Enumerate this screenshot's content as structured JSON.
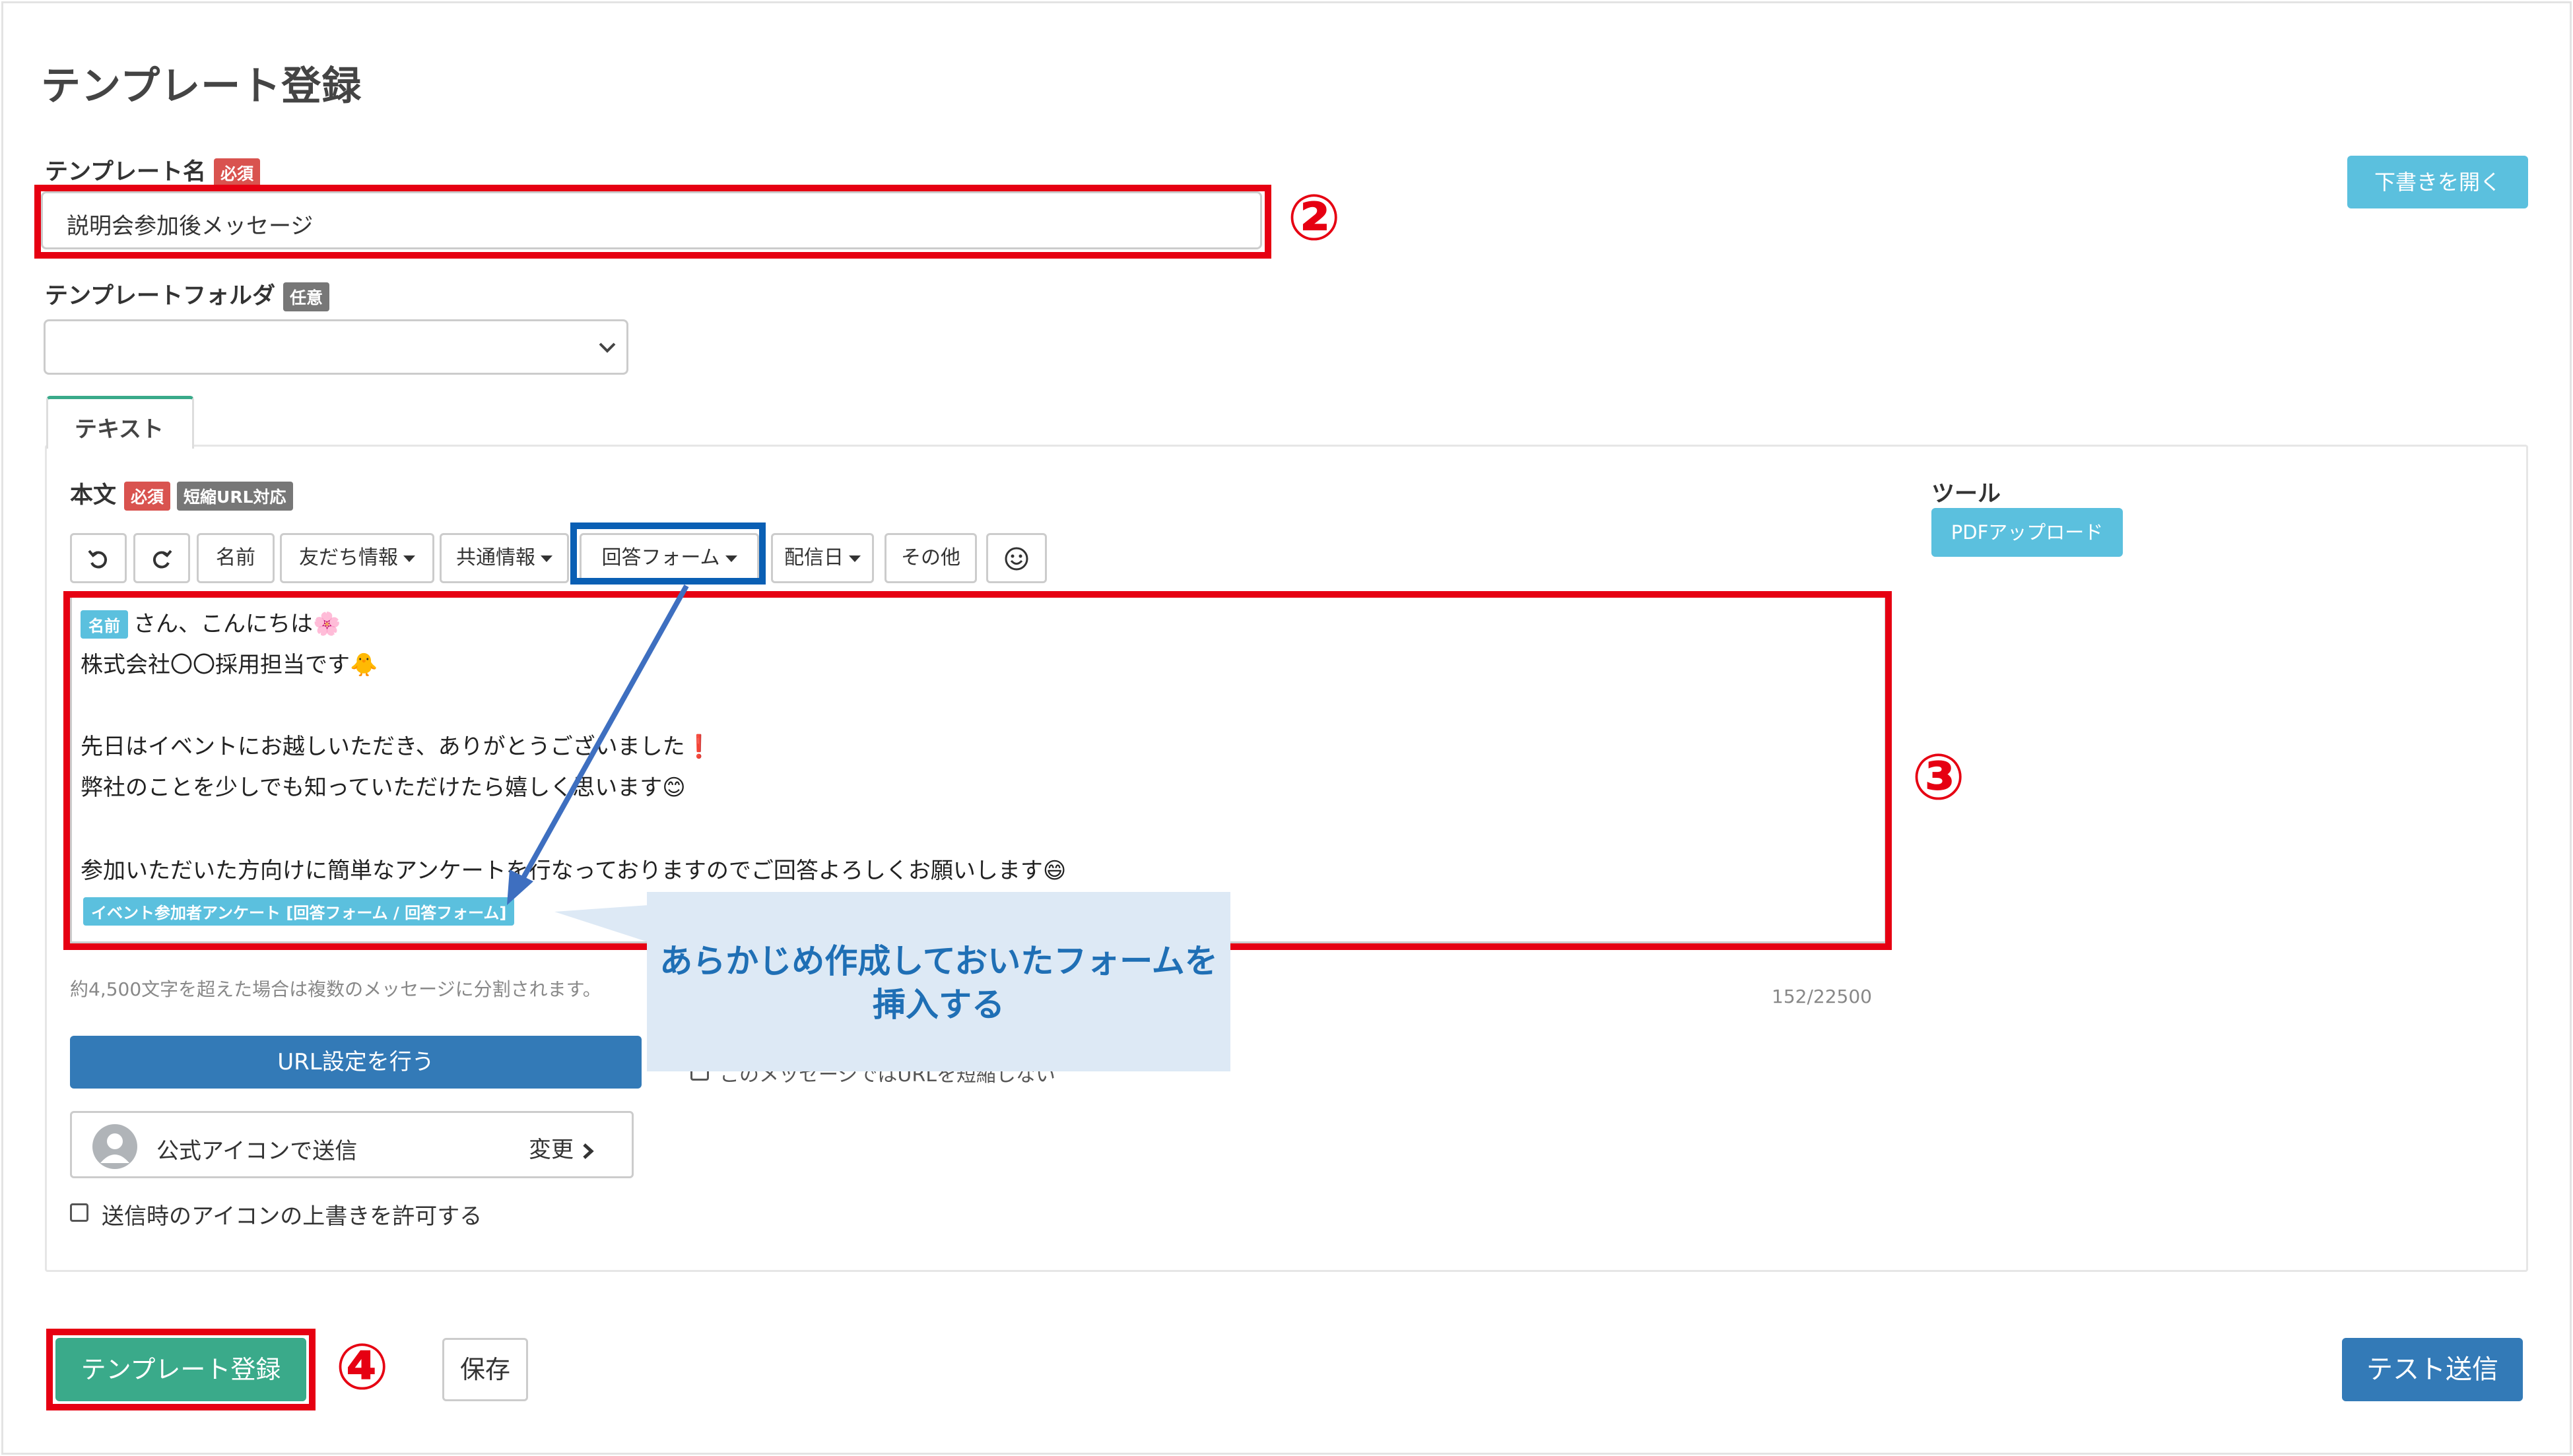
{
  "page": {
    "title": "テンプレート登録"
  },
  "template_name": {
    "label": "テンプレート名",
    "badge": "必須",
    "value": "説明会参加後メッセージ"
  },
  "open_draft_button": "下書きを開く",
  "template_folder": {
    "label": "テンプレートフォルダ",
    "badge": "任意",
    "value": ""
  },
  "tabs": [
    {
      "label": "テキスト"
    }
  ],
  "body": {
    "label": "本文",
    "badge_required": "必須",
    "badge_short_url": "短縮URL対応",
    "toolbar": {
      "undo_icon": "undo-icon",
      "redo_icon": "redo-icon",
      "name": "名前",
      "friend_info": "友だち情報",
      "common_info": "共通情報",
      "answer_form": "回答フォーム",
      "delivery_date": "配信日",
      "other": "その他",
      "emoji_icon": "smile-icon"
    },
    "editor": {
      "chip_name": "名前",
      "line1_text": "さん、こんにちは🌸",
      "line2": "株式会社〇〇採用担当です🐥",
      "line3": "先日はイベントにお越しいただき、ありがとうございました❗",
      "line4": "弊社のことを少しでも知っていただけたら嬉しく思います😊",
      "line5": "参加いただいた方向けに簡単なアンケートを行なっておりますのでご回答よろしくお願いします😄",
      "form_chip": "イベント参加者アンケート [回答フォーム / 回答フォーム]"
    },
    "split_note": "約4,500文字を超えた場合は複数のメッセージに分割されます。",
    "char_count": "152/22500"
  },
  "tools": {
    "label": "ツール",
    "pdf_upload": "PDFアップロード"
  },
  "url_settings_button": "URL設定を行う",
  "sender": {
    "label": "公式アイコンで送信",
    "change": "変更"
  },
  "icon_override_checkbox": "送信時のアイコンの上書きを許可する",
  "hidden_checkbox_partial": "このメッセージではURLを短縮しない",
  "callout": {
    "text": "あらかじめ作成しておいたフォームを挿入する"
  },
  "annotations": {
    "n2": "②",
    "n3": "③",
    "n4": "④"
  },
  "footer": {
    "register": "テンプレート登録",
    "save": "保存",
    "test_send": "テスト送信"
  },
  "colors": {
    "accent_red": "#e60012",
    "accent_blue": "#0a5fb4",
    "info": "#5bc0de",
    "primary": "#337ab7",
    "success": "#3aaa8a"
  }
}
